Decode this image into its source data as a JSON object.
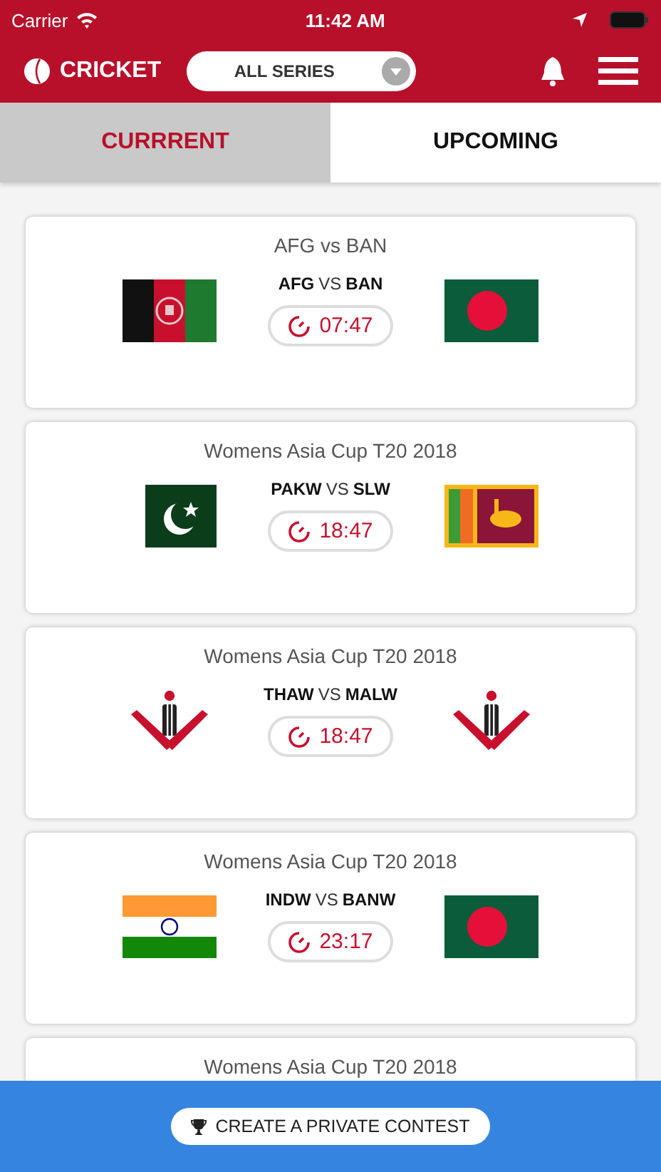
{
  "status_bar": {
    "carrier": "Carrier",
    "time": "11:42 AM"
  },
  "header": {
    "logo": "CRICKET",
    "series_dropdown": "ALL SERIES"
  },
  "tabs": [
    {
      "label": "CURRRENT",
      "selected": true
    },
    {
      "label": "UPCOMING",
      "selected": false
    }
  ],
  "matches": [
    {
      "series": "AFG vs BAN",
      "teams": [
        {
          "code": "AFG",
          "kind": "afg"
        },
        {
          "code": "BAN",
          "kind": "ban"
        }
      ],
      "vs": "VS",
      "time": "07:47"
    },
    {
      "series": "Womens Asia Cup T20 2018",
      "teams": [
        {
          "code": "PAKW",
          "kind": "pak"
        },
        {
          "code": "SLW",
          "kind": "sl"
        }
      ],
      "vs": "VS",
      "time": "18:47"
    },
    {
      "series": "Womens Asia Cup T20 2018",
      "teams": [
        {
          "code": "THAW",
          "kind": "generic"
        },
        {
          "code": "MALW",
          "kind": "generic"
        }
      ],
      "vs": "VS",
      "time": "18:47"
    },
    {
      "series": "Womens Asia Cup T20 2018",
      "teams": [
        {
          "code": "INDW",
          "kind": "ind"
        },
        {
          "code": "BANW",
          "kind": "ban"
        }
      ],
      "vs": "VS",
      "time": "23:17"
    },
    {
      "series": "Womens Asia Cup T20 2018"
    }
  ],
  "bottom_button": "CREATE A PRIVATE CONTEST"
}
